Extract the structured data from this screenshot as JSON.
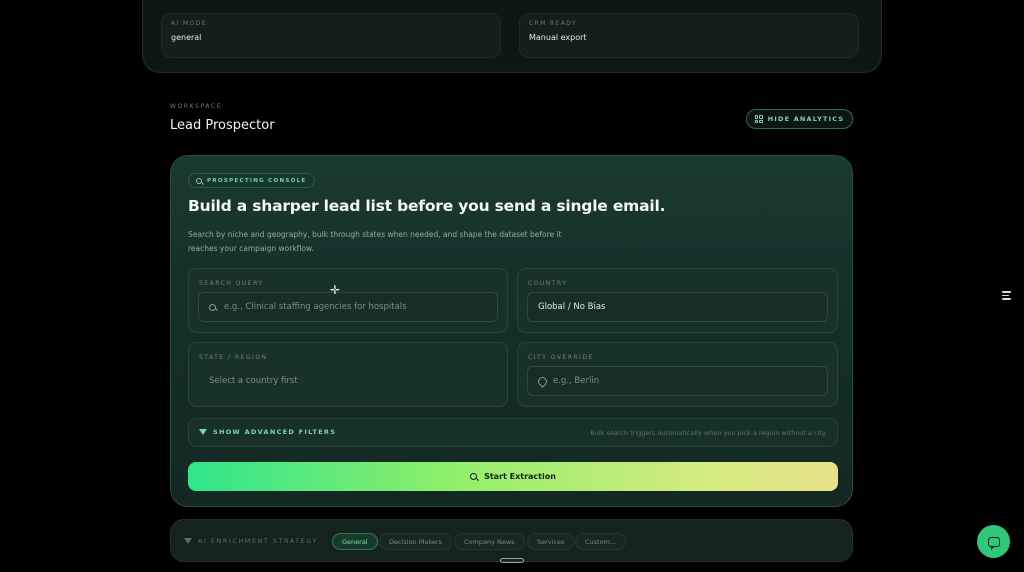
{
  "stats": [
    {
      "label": "AI MODE",
      "value": "general"
    },
    {
      "label": "CRM READY",
      "value": "Manual export"
    }
  ],
  "workspace": {
    "eyebrow": "WORKSPACE",
    "title": "Lead Prospector",
    "hide_analytics": "HIDE ANALYTICS"
  },
  "console": {
    "tag": "PROSPECTING CONSOLE",
    "headline": "Build a sharper lead list before you send a single email.",
    "subline": "Search by niche and geography, bulk through states when needed, and shape the dataset before it reaches your campaign workflow.",
    "search": {
      "label": "SEARCH QUERY",
      "placeholder": "e.g., Clinical staffing agencies for hospitals"
    },
    "country": {
      "label": "COUNTRY",
      "value": "Global / No Bias"
    },
    "state": {
      "label": "STATE / REGION",
      "placeholder": "Select a country first"
    },
    "city": {
      "label": "CITY OVERRIDE",
      "placeholder": "e.g., Berlin"
    },
    "advanced": {
      "label": "SHOW ADVANCED FILTERS",
      "hint": "Bulk search triggers automatically when you pick a region without a city."
    },
    "start": "Start Extraction"
  },
  "enrichment": {
    "label": "AI ENRICHMENT STRATEGY",
    "options": [
      "General",
      "Decision Makers",
      "Company News",
      "Services",
      "Custom..."
    ],
    "selected": "General"
  },
  "colors": {
    "accent": "#2ee68d",
    "accent_end": "#e7e18a",
    "background": "#000000"
  },
  "icons": [
    "grid-icon",
    "search-icon",
    "pin-icon",
    "funnel-icon",
    "settings-sliders-icon",
    "chat-icon"
  ]
}
